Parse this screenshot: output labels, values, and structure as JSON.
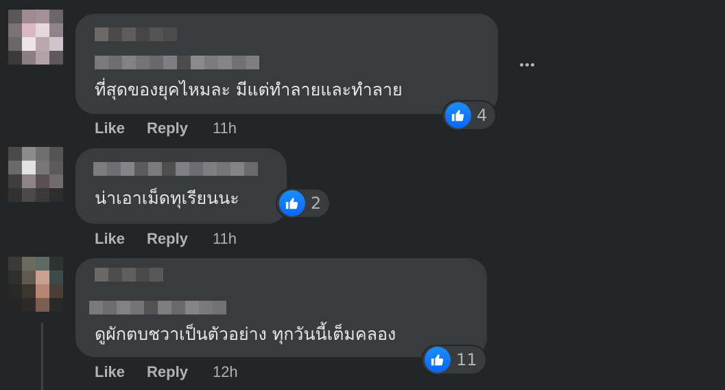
{
  "comments": [
    {
      "text": "ที่สุดของยุคไหมละ มีแต่ทำลายและทำลาย",
      "reaction_count": "4",
      "like_label": "Like",
      "reply_label": "Reply",
      "time": "11h"
    },
    {
      "text": "น่าเอาเม็ดทุเรียนนะ",
      "reaction_count": "2",
      "like_label": "Like",
      "reply_label": "Reply",
      "time": "11h"
    },
    {
      "text": "ดูผักตบชวาเป็นตัวอย่าง ทุกวันนี้เต็มคลอง",
      "reaction_count": "11",
      "like_label": "Like",
      "reply_label": "Reply",
      "time": "12h"
    }
  ],
  "icons": {
    "reaction": "thumbs-up-icon",
    "more": "more-options-icon"
  },
  "colors": {
    "background": "#242526",
    "bubble": "#3a3b3c",
    "text": "#e4e6eb",
    "secondary_text": "#b0b3b8",
    "like_blue": "#0866ff"
  }
}
